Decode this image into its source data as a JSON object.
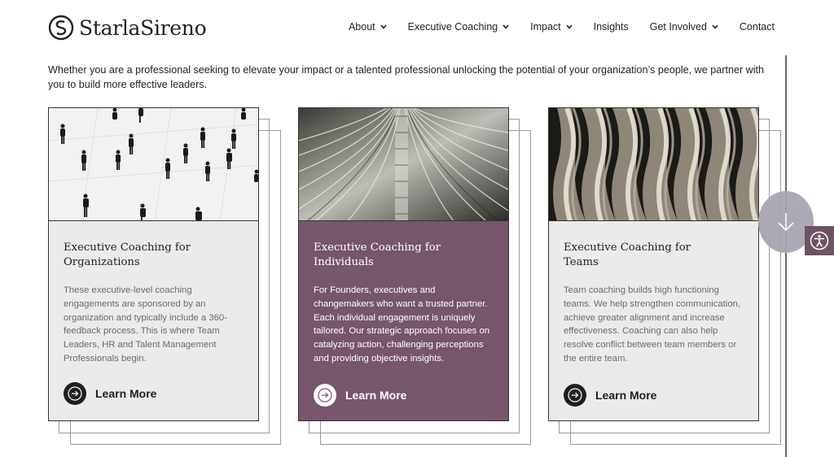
{
  "header": {
    "logo_text": "StarlaSireno",
    "nav": [
      {
        "label": "About",
        "has_dropdown": true
      },
      {
        "label": "Executive Coaching",
        "has_dropdown": true
      },
      {
        "label": "Impact",
        "has_dropdown": true
      },
      {
        "label": "Insights",
        "has_dropdown": false
      },
      {
        "label": "Get Involved",
        "has_dropdown": true
      },
      {
        "label": "Contact",
        "has_dropdown": false
      }
    ]
  },
  "intro": "Whether you are a professional seeking to elevate your impact or a talented professional unlocking the potential of your organization’s people, we partner with you to build more effective leaders.",
  "cards": [
    {
      "title_line1": "Executive Coaching for",
      "title_line2": "Organizations",
      "body": "These executive-level coaching engagements are sponsored by an organization and typically include a 360-feedback process. This is where Team Leaders, HR and Talent Management Professionals begin.",
      "cta": "Learn More",
      "image": "people-walking-photo"
    },
    {
      "title_line1": "Executive Coaching for",
      "title_line2": "Individuals",
      "body": "For Founders, executives and changemakers who want a trusted partner. Each individual engagement is uniquely tailored. Our strategic approach focuses on catalyzing action, challenging perceptions and providing objective insights.",
      "cta": "Learn More",
      "image": "architecture-ribs-photo"
    },
    {
      "title_line1": "Executive Coaching for",
      "title_line2": "Teams",
      "body": "Team coaching builds high functioning teams. We help strengthen communication, achieve greater alignment and increase effectiveness. Coaching can also help resolve conflict between team members or the entire team.",
      "cta": "Learn More",
      "image": "wave-pattern-photo"
    }
  ],
  "colors": {
    "accent_purple": "#76566b",
    "card_gray": "#ebebeb",
    "scroll_circle": "#a9a5b1",
    "accessibility_bg": "#6e5364"
  }
}
